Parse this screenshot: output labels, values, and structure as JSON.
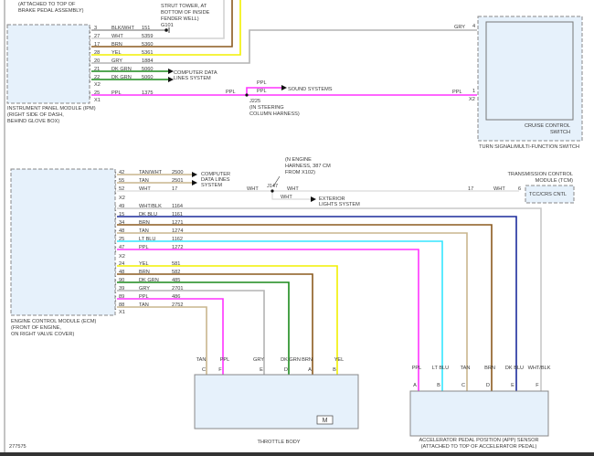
{
  "wire_colors": {
    "TAN": "#c9b68e",
    "TAN/WHT": "#c9b68e",
    "WHT": "#d2d2d2",
    "WHT/BLK": "#c8c8c8",
    "BRN": "#8b5a1e",
    "YEL": "#f2f000",
    "GRY": "#b4b4b4",
    "DK GRN": "#1b8a1b",
    "PPL": "#ff33ff",
    "DK BLU": "#1c2b9c",
    "LT BLU": "#35e6ff",
    "BLK/WHT": "#9a9a9a"
  },
  "module_fill": "#e6f1fb",
  "top_notes": {
    "brake_1": "(ATTACHED TO TOP OF",
    "brake_2": "BRAKE PEDAL ASSEMBLY)",
    "strut_1": "STRUT TOWER, AT",
    "strut_2": "BOTTOM OF INSIDE",
    "strut_3": "FENDER WELL)",
    "ground": "G101"
  },
  "ipm": {
    "caption": [
      "INSTRUMENT PANEL MODULE (IPM)",
      "(RIGHT SIDE OF DASH,",
      "BEHIND GLOVE BOX)"
    ],
    "pins": [
      {
        "label": "GND",
        "pin": "3",
        "color": "BLK/WHT",
        "circuit": "151"
      },
      {
        "label": "5 V REF",
        "pin": "27",
        "color": "WHT",
        "circuit": "5359"
      },
      {
        "label": "LO REF",
        "pin": "17",
        "color": "BRN",
        "circuit": "5360"
      },
      {
        "label": "SENS SIG",
        "pin": "28",
        "color": "YEL",
        "circuit": "5361"
      },
      {
        "label": "CRUISE SW SIG",
        "pin": "20",
        "color": "GRY",
        "circuit": "1884"
      },
      {
        "label": "SERIAL DATA GMLAN",
        "pin": "21",
        "color": "DK GRN",
        "circuit": "5060"
      },
      {
        "label": "SERIAL DATA GMLAN",
        "pin": "22",
        "color": "DK GRN",
        "circuit": "5060"
      },
      {
        "label": "ACCY SUPPLY",
        "pin": "25",
        "color": "PPL",
        "circuit": "1375"
      }
    ],
    "connector_x2": "X2",
    "connector_x1": "X1",
    "data_lines_1": "COMPUTER DATA",
    "data_lines_2": "LINES SYSTEM",
    "ppl_1": "PPL",
    "ppl_2": "PPL",
    "ppl_3": "PPL",
    "sound": "SOUND SYSTEMS",
    "splice": "J225",
    "splice_note_1": "(IN STEERING",
    "splice_note_2": "COLUMN HARNESS)"
  },
  "switch": {
    "gry_label": "GRY",
    "gry_pin": "4",
    "ppl_label": "PPL",
    "ppl_pin": "1",
    "connector": "X2",
    "inner_1": "CRUISE CONTROL",
    "inner_2": "SWITCH",
    "outer": "TURN SIGNAL/MULTI-FUNCTION SWITCH"
  },
  "ecm": {
    "caption": [
      "ENGINE CONTROL MODULE (ECM)",
      "(FRONT OF ENGINE,",
      "ON RIGHT VALVE COVER)"
    ],
    "pins": [
      {
        "label": "SERIAL DATA BUS +",
        "pin": "42",
        "color": "TAN/WHT",
        "circuit": "2500"
      },
      {
        "label": "SERIAL DATA BUS -",
        "pin": "55",
        "color": "TAN",
        "circuit": "2501"
      },
      {
        "label": "TCC/CRUISE CONTROL RELEASE SIG",
        "pin": "52",
        "color": "WHT",
        "circuit": "17"
      },
      {
        "label": "5 VOLT REFERENCE 2",
        "pin": "49",
        "color": "WHT/BLK",
        "circuit": "1164"
      },
      {
        "label": "APP SENSOR 1 SIGNAL",
        "pin": "15",
        "color": "DK BLU",
        "circuit": "1161"
      },
      {
        "label": "LOW REFERENCE",
        "pin": "34",
        "color": "BRN",
        "circuit": "1271"
      },
      {
        "label": "5 VOLT REFERENCE 1",
        "pin": "48",
        "color": "TAN",
        "circuit": "1274"
      },
      {
        "label": "APP SENSOR 2 SIGNAL",
        "pin": "25",
        "color": "LT BLU",
        "circuit": "1162"
      },
      {
        "label": "LOW REFERENCE",
        "pin": "47",
        "color": "PPL",
        "circuit": "1272"
      },
      {
        "label": "TAC MOTOR CONTROL-1",
        "pin": "24",
        "color": "YEL",
        "circuit": "581"
      },
      {
        "label": "TAC MOTOR CONTROL-2",
        "pin": "48",
        "color": "BRN",
        "circuit": "582"
      },
      {
        "label": "TP SENSOR 1 SIGNAL",
        "pin": "90",
        "color": "DK GRN",
        "circuit": "485"
      },
      {
        "label": "5 VOLT REFERENCE",
        "pin": "39",
        "color": "GRY",
        "circuit": "2701"
      },
      {
        "label": "TP SENSOR 2 SIGNAL",
        "pin": "89",
        "color": "PPL",
        "circuit": "486"
      },
      {
        "label": "LOW REFERENCE",
        "pin": "88",
        "color": "TAN",
        "circuit": "2752"
      }
    ],
    "connector_x2a": "X2",
    "connector_x2b": "X2",
    "connector_x1": "X1",
    "data_lines_1": "COMPUTER",
    "data_lines_2": "DATA LINES",
    "data_lines_3": "SYSTEM",
    "wht_1": "WHT",
    "wht_2": "WHT",
    "wht_3": "WHT",
    "wht_4": "WHT",
    "splice": "J147",
    "splice_note_1": "(N ENGINE",
    "splice_note_2": "HARNESS, 387 CM",
    "splice_note_3": "FROM X102)",
    "exterior_1": "EXTERIOR",
    "exterior_2": "LIGHTS SYSTEM",
    "tcm_circuit": "17",
    "tcm_pin": "6"
  },
  "tcm": {
    "title_1": "TRANSMISSION CONTROL",
    "title_2": "MODULE (TCM)",
    "pin_label": "TCC/CRS CNTL"
  },
  "throttle": {
    "name": "THROTTLE BODY",
    "pins": [
      {
        "letter": "C",
        "color": "TAN"
      },
      {
        "letter": "F",
        "color": "PPL"
      },
      {
        "letter": "E",
        "color": "GRY"
      },
      {
        "letter": "D",
        "color": "DK GRN"
      },
      {
        "letter": "A",
        "color": "BRN"
      },
      {
        "letter": "B",
        "color": "YEL"
      }
    ],
    "motor": "M"
  },
  "app": {
    "name_1": "ACCELERATOR PEDAL POSITION (APP) SENSOR",
    "name_2": "(ATTACHED TO TOP OF ACCELERATOR PEDAL)",
    "pins": [
      {
        "letter": "A",
        "color": "PPL"
      },
      {
        "letter": "B",
        "color": "LT BLU"
      },
      {
        "letter": "C",
        "color": "TAN"
      },
      {
        "letter": "D",
        "color": "BRN"
      },
      {
        "letter": "E",
        "color": "DK BLU"
      },
      {
        "letter": "F",
        "color": "WHT/BLK"
      }
    ]
  },
  "figure_id": "277575"
}
